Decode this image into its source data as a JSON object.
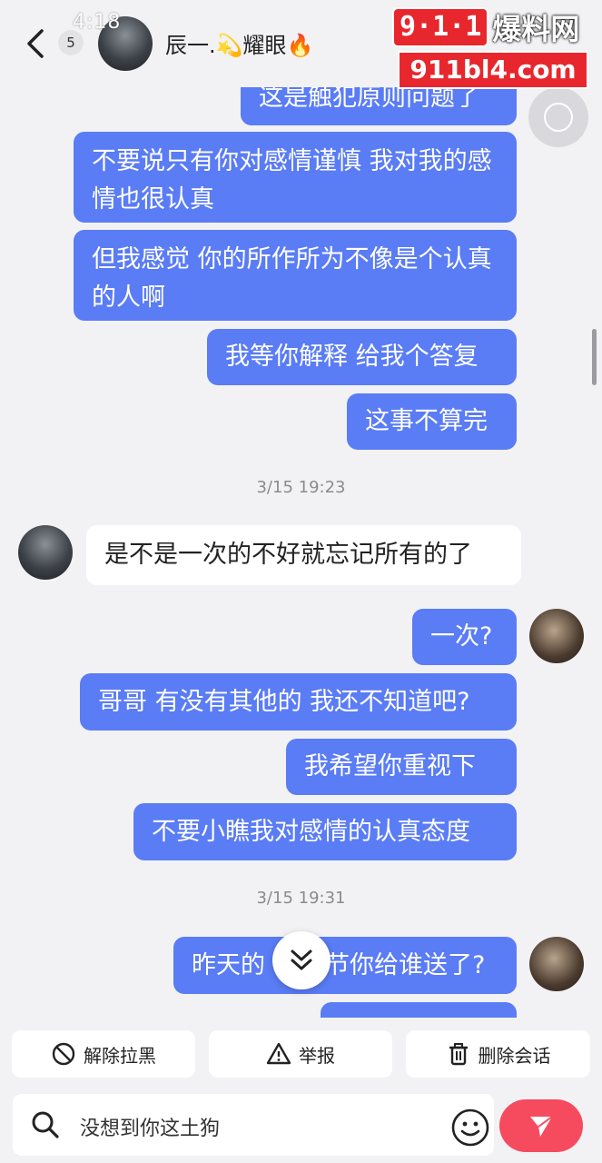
{
  "status_bar": {
    "time": "4:18"
  },
  "header": {
    "unread_count": "5",
    "contact_name": "辰一.💫耀眼🔥"
  },
  "watermark": {
    "badge": "9·1·1",
    "text": "爆料网",
    "url": "911bl4.com"
  },
  "messages": [
    {
      "side": "me",
      "text": "这是触犯原则问题了"
    },
    {
      "side": "me",
      "text": "不要说只有你对感情谨慎 我对我的感情也很认真"
    },
    {
      "side": "me",
      "text": "但我感觉 你的所作所为不像是个认真的人啊"
    },
    {
      "side": "me",
      "text": "我等你解释 给我个答复"
    },
    {
      "side": "me",
      "text": "这事不算完"
    },
    {
      "timestamp": "3/15 19:23"
    },
    {
      "side": "them",
      "text": "是不是一次的不好就忘记所有的了"
    },
    {
      "side": "me",
      "text": "一次?"
    },
    {
      "side": "me",
      "text": "哥哥 有没有其他的 我还不知道吧?"
    },
    {
      "side": "me",
      "text": "我希望你重视下"
    },
    {
      "side": "me",
      "text": "不要小瞧我对感情的认真态度"
    },
    {
      "timestamp": "3/15 19:31"
    },
    {
      "side": "me",
      "text_left": "昨天的",
      "text_right": "节你给谁送了?"
    }
  ],
  "actions": [
    {
      "label": "解除拉黑",
      "icon": "ban-icon"
    },
    {
      "label": "举报",
      "icon": "warning-icon"
    },
    {
      "label": "删除会话",
      "icon": "trash-icon"
    }
  ],
  "input": {
    "value": "没想到你这土狗"
  },
  "colors": {
    "my_bubble": "#5a7cf5",
    "send": "#f64a5e",
    "background": "#f2f2f4"
  }
}
